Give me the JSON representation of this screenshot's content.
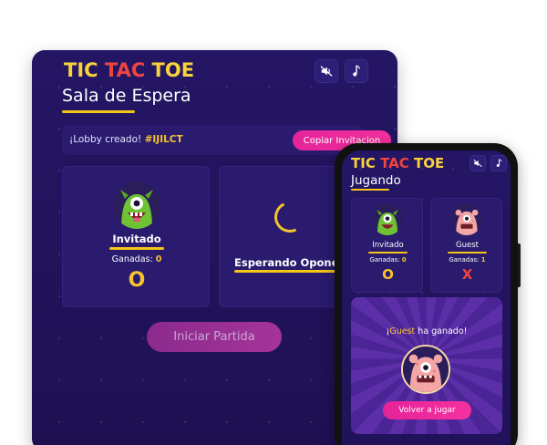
{
  "app": {
    "logo_parts": [
      "TIC",
      "TAC",
      "TOE"
    ]
  },
  "tablet": {
    "heading": "Sala de Espera",
    "lobby": {
      "message": "¡Lobby creado!",
      "code": "#IJILCT",
      "copy_label": "Copiar Invitacion"
    },
    "player1": {
      "name": "Invitado",
      "wins_label": "Ganadas:",
      "wins": "0",
      "mark": "O"
    },
    "player2": {
      "status": "Esperando Oponente"
    },
    "start_label": "Iniciar Partida"
  },
  "phone": {
    "heading": "Jugando",
    "player1": {
      "name": "Invitado",
      "wins_label": "Ganadas:",
      "wins": "0",
      "mark": "O"
    },
    "player2": {
      "name": "Guest",
      "wins_label": "Ganadas:",
      "wins": "1",
      "mark": "X"
    },
    "result": {
      "prefix": "¡",
      "winner": "Guest",
      "suffix": " ha ganado!"
    },
    "again_label": "Volver a jugar"
  },
  "colors": {
    "background": "#22135c",
    "card": "#2a1b6f",
    "accent_yellow": "#f6c42b",
    "accent_pink": "#e5249a",
    "accent_red": "#f0453f"
  },
  "icons": [
    "mute-icon",
    "music-note-icon",
    "spinner-icon",
    "green-monster-avatar",
    "pink-monster-avatar"
  ]
}
